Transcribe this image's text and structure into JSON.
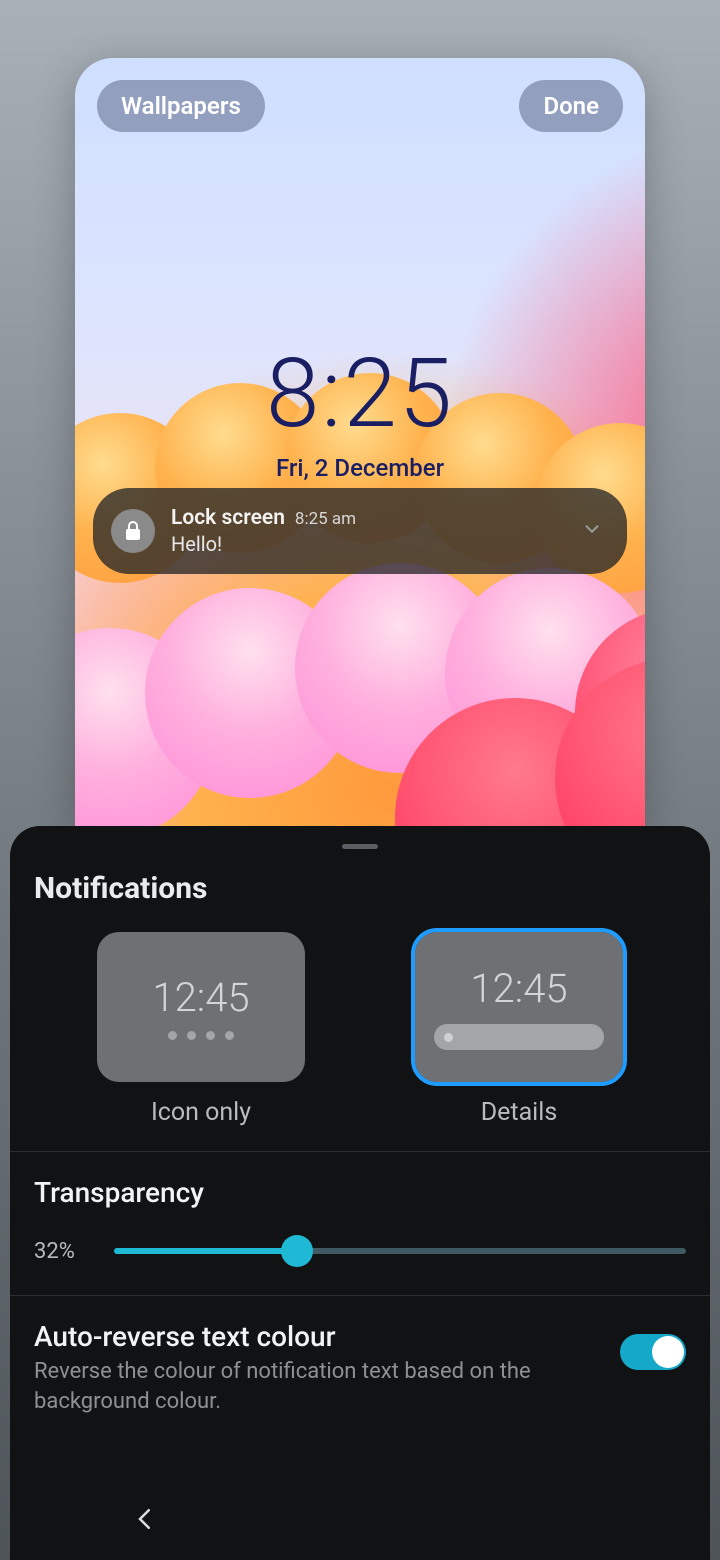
{
  "header": {
    "wallpapers": "Wallpapers",
    "done": "Done"
  },
  "clock": {
    "time": "8:25",
    "date": "Fri, 2 December"
  },
  "notification": {
    "app": "Lock screen",
    "time": "8:25 am",
    "body": "Hello!",
    "icon": "lock-icon"
  },
  "panel": {
    "title": "Notifications",
    "options": [
      {
        "preview_time": "12:45",
        "label": "Icon only",
        "style": "dots",
        "selected": false
      },
      {
        "preview_time": "12:45",
        "label": "Details",
        "style": "bar",
        "selected": true
      }
    ],
    "transparency": {
      "title": "Transparency",
      "value_label": "32%",
      "value": 32
    },
    "auto_reverse": {
      "title": "Auto-reverse text colour",
      "description": "Reverse the colour of notification text based on the background colour.",
      "enabled": true
    }
  },
  "colors": {
    "accent": "#1fb9d6",
    "selection": "#1e9cff"
  }
}
